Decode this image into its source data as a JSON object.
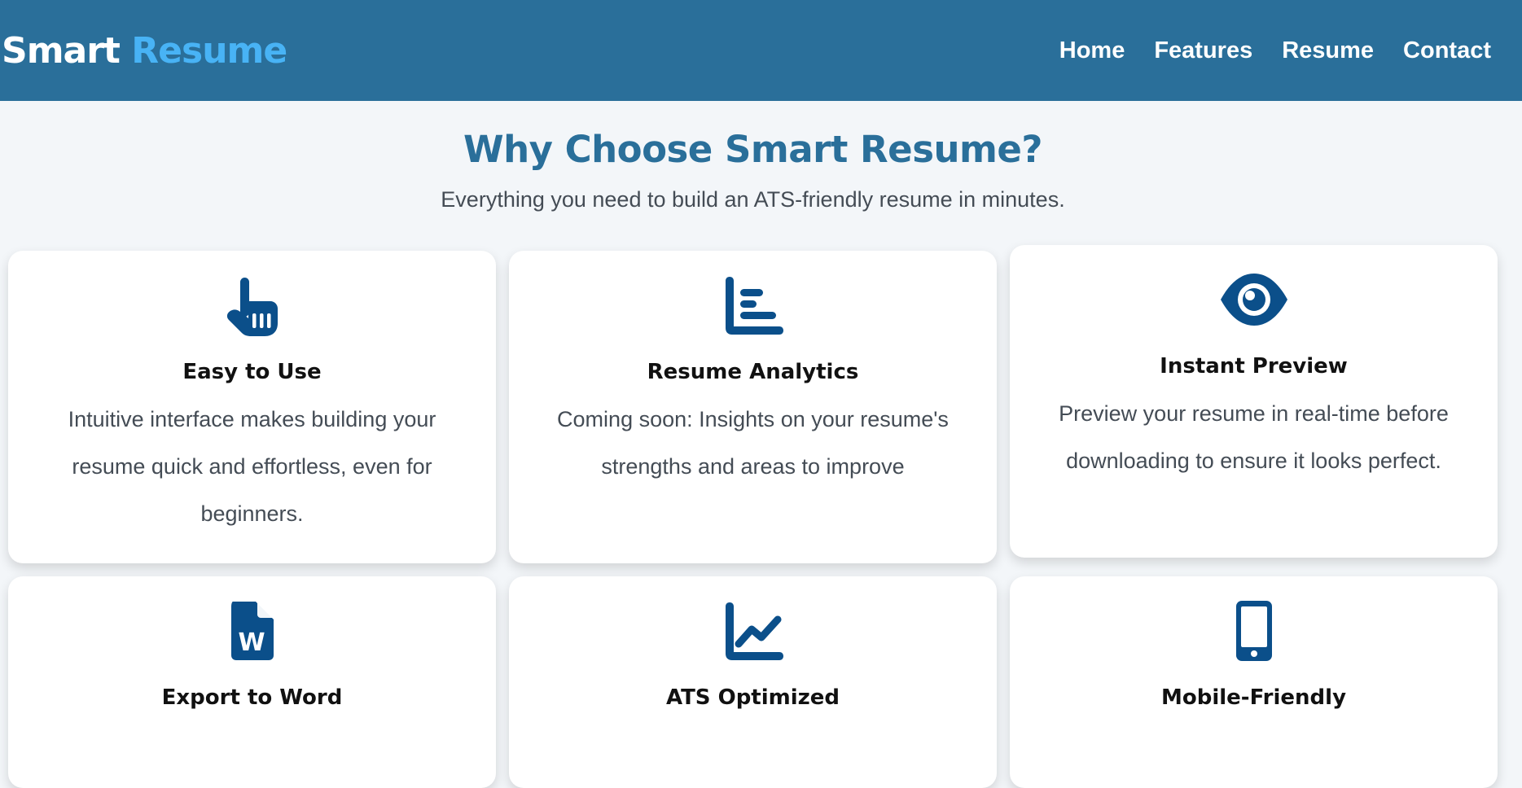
{
  "header": {
    "brand_main": "Smart",
    "brand_accent": "Resume",
    "nav": [
      "Home",
      "Features",
      "Resume",
      "Contact"
    ]
  },
  "features": {
    "title": "Why Choose Smart Resume?",
    "subtitle": "Everything you need to build an ATS-friendly resume in minutes.",
    "cards": [
      {
        "icon": "pointing-hand-icon",
        "title": "Easy to Use",
        "desc": "Intuitive interface makes building your resume quick and effortless, even for beginners."
      },
      {
        "icon": "bar-chart-icon",
        "title": "Resume Analytics",
        "desc": "Coming soon: Insights on your resume's strengths and areas to improve"
      },
      {
        "icon": "eye-icon",
        "title": "Instant Preview",
        "desc": "Preview your resume in real-time before downloading to ensure it looks perfect."
      },
      {
        "icon": "word-file-icon",
        "title": "Export to Word",
        "desc": ""
      },
      {
        "icon": "line-chart-icon",
        "title": "ATS Optimized",
        "desc": ""
      },
      {
        "icon": "mobile-phone-icon",
        "title": "Mobile-Friendly",
        "desc": ""
      }
    ]
  },
  "colors": {
    "header_bg": "#2a6f9a",
    "brand_accent": "#48b3f5",
    "title": "#2a6f9a",
    "icon": "#0b4f8a"
  }
}
